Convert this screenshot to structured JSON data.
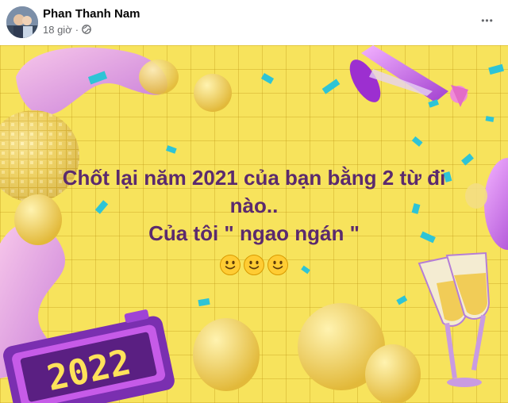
{
  "post": {
    "author_name": "Phan Thanh Nam",
    "time_label": "18 giờ",
    "separator": "·",
    "more_label": "•••"
  },
  "icons": {
    "avatar": "profile-photo",
    "privacy": "globe-icon",
    "more": "more-options-icon",
    "emoji": "slightly-smiling-face-icon"
  },
  "banner": {
    "line1": "Chốt lại năm 2021 của bạn bằng 2 từ đi",
    "line2": "nào..",
    "line3": "Của tôi \" ngao ngán \"",
    "emoji_count": 3,
    "clock_text": "2022",
    "colors": {
      "background": "#f7e35c",
      "text": "#5b2a6e",
      "accent_purple": "#b04ad6",
      "confetti": "#2ec4d6"
    }
  }
}
